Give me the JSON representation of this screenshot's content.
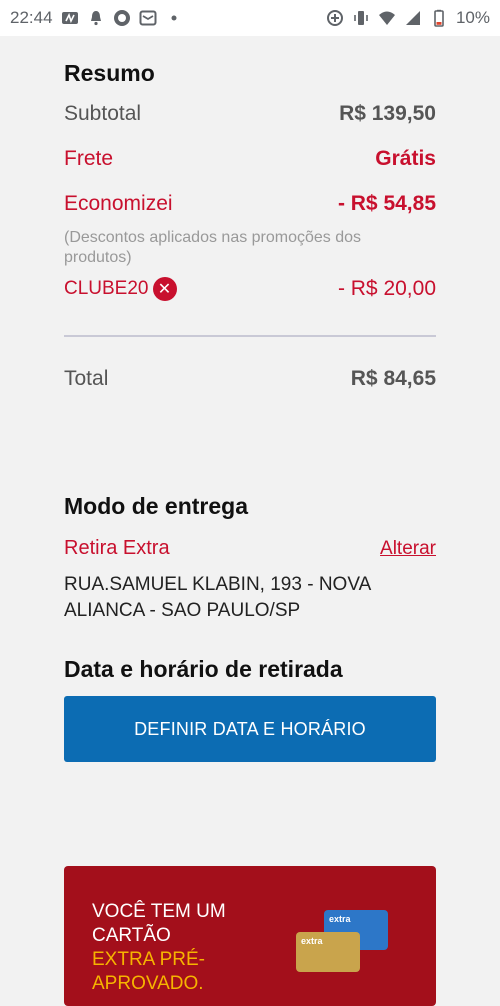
{
  "status_bar": {
    "time": "22:44",
    "battery": "10%"
  },
  "summary": {
    "title": "Resumo",
    "subtotal_label": "Subtotal",
    "subtotal_value": "R$ 139,50",
    "shipping_label": "Frete",
    "shipping_value": "Grátis",
    "saved_label": "Economizei",
    "saved_value": "- R$ 54,85",
    "saved_note": "(Descontos aplicados nas promoções dos produtos)",
    "coupon_code": "CLUBE20",
    "coupon_value": "- R$ 20,00",
    "total_label": "Total",
    "total_value": "R$ 84,65"
  },
  "delivery": {
    "title": "Modo de entrega",
    "method": "Retira Extra",
    "change_link": "Alterar",
    "address_line1": "RUA.SAMUEL KLABIN, 193 - NOVA",
    "address_line2": "ALIANCA - SAO PAULO/SP"
  },
  "pickup": {
    "title": "Data e horário de retirada",
    "button_label": "DEFINIR DATA E HORÁRIO"
  },
  "promo": {
    "line1": "VOCÊ TEM UM",
    "line2": "CARTÃO",
    "highlight1": "EXTRA PRÉ-",
    "highlight2": "APROVADO.",
    "card_brand": "extra"
  },
  "colors": {
    "accent_red": "#c8102e",
    "button_blue": "#0c6cb3",
    "promo_red": "#a30f1b",
    "promo_yellow": "#f6b400"
  }
}
